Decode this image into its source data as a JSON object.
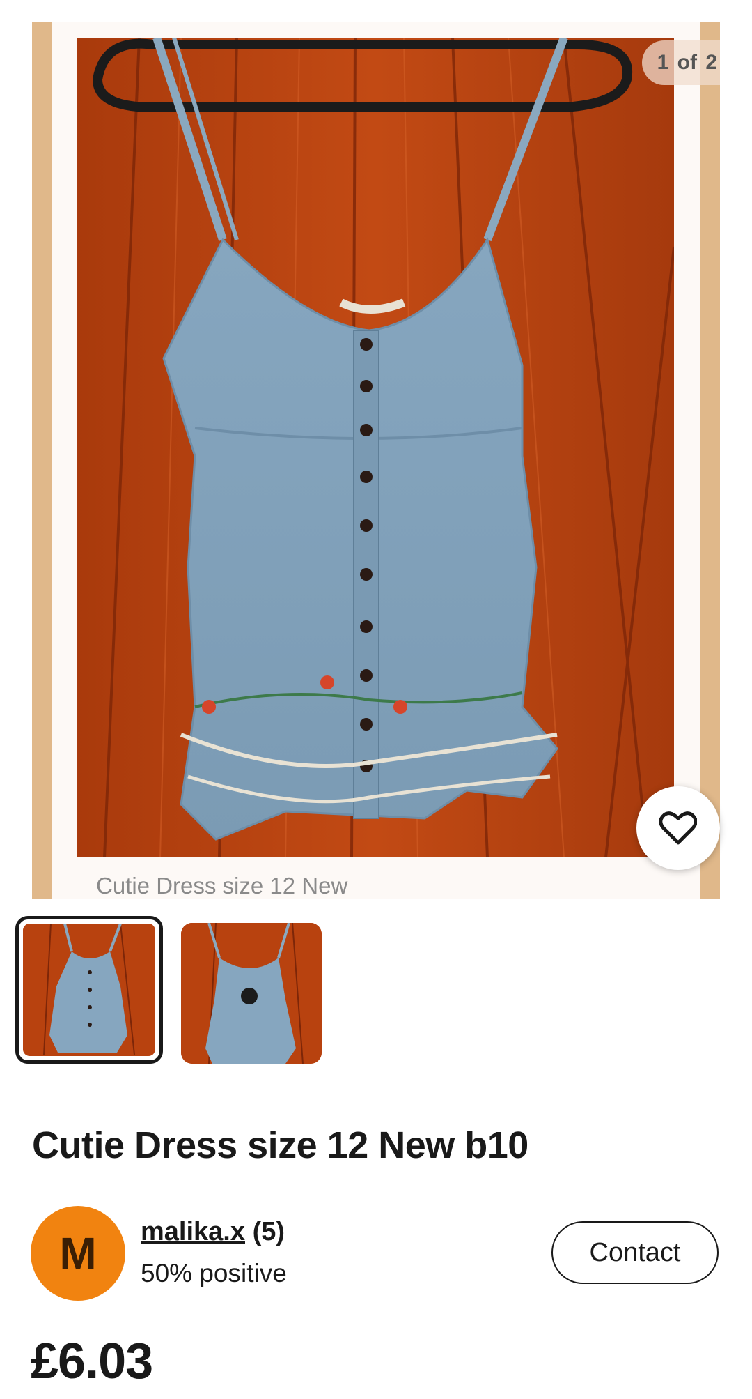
{
  "gallery": {
    "counter_current": "1",
    "counter_separator": "of",
    "counter_total": "2",
    "caption": "Cutie Dress size 12 New",
    "favorite_icon": "heart-outline-icon",
    "thumbnails": [
      {
        "selected": true
      },
      {
        "selected": false
      }
    ]
  },
  "listing": {
    "title": "Cutie Dress size 12 New b10",
    "price": "£6.03"
  },
  "seller": {
    "avatar_initial": "M",
    "avatar_color": "#f18310",
    "username": "malika.x",
    "feedback_count": "(5)",
    "feedback_percent": "50% positive",
    "contact_label": "Contact"
  },
  "colors": {
    "text": "#191919",
    "caption": "#8a8a8a",
    "wood": "#b8420f"
  }
}
